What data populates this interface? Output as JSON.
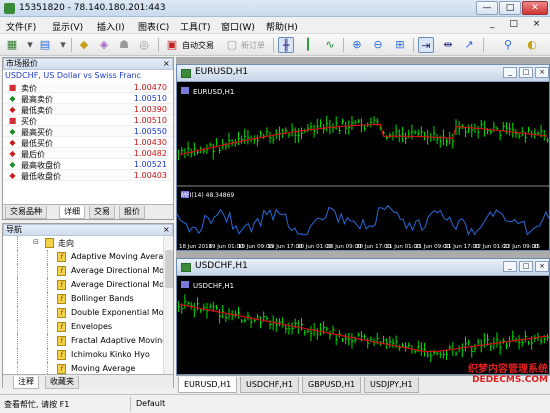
{
  "window": {
    "title": "15351820 - 78.140.180.201:443",
    "min": "—",
    "max": "□",
    "close": "✕"
  },
  "menu": [
    "文件(F)",
    "显示(V)",
    "插入(I)",
    "图表(C)",
    "工具(T)",
    "窗口(W)",
    "帮助(H)"
  ],
  "mdi_controls": "_ □ ×",
  "toolbar": {
    "auto_trade": "自动交易",
    "new_order": "新订单"
  },
  "market_watch": {
    "title": "市场报价",
    "close": "×",
    "symbol": "USDCHF, US Dollar vs Swiss Franc",
    "rows": [
      {
        "label": "卖价",
        "value": "1.00470",
        "arrow": "none"
      },
      {
        "label": "最高卖价",
        "value": "1.00510",
        "arrow": "up"
      },
      {
        "label": "最低卖价",
        "value": "1.00390",
        "arrow": "down"
      },
      {
        "label": "买价",
        "value": "1.00510",
        "arrow": "none"
      },
      {
        "label": "最高买价",
        "value": "1.00550",
        "arrow": "up"
      },
      {
        "label": "最低买价",
        "value": "1.00430",
        "arrow": "down"
      },
      {
        "label": "最后价",
        "value": "1.00482",
        "arrow": "down"
      },
      {
        "label": "最高收盘价",
        "value": "1.00521",
        "arrow": "up"
      },
      {
        "label": "最低收盘价",
        "value": "1.00403",
        "arrow": "down"
      }
    ],
    "tabs": [
      "交易品种",
      "详细",
      "交易",
      "报价"
    ],
    "active_tab": 1
  },
  "navigator": {
    "title": "导航",
    "close": "×",
    "folder": "走向",
    "items": [
      "Adaptive Moving Average",
      "Average Directional Movement",
      "Average Directional Movement Wilder",
      "Bollinger Bands",
      "Double Exponential Moving Average",
      "Envelopes",
      "Fractal Adaptive Moving Average",
      "Ichimoku Kinko Hyo",
      "Moving Average"
    ],
    "tabs": [
      "注释",
      "收藏夹"
    ],
    "active_tab": 0
  },
  "status": {
    "help": "查看帮忙, 请按 F1",
    "profile": "Default"
  },
  "charts": [
    {
      "window_title": "EURUSD,H1",
      "label": "EURUSD,H1",
      "indicator": "MFI(14) 48.34869",
      "time_labels": [
        "18 Jun 2018",
        "19 Jun 01:00",
        "19 Jun 09:00",
        "19 Jun 17:00",
        "20 Jun 01:00",
        "20 Jun 09:00",
        "20 Jun 17:00",
        "21 Jun 01:00",
        "21 Jun 09:00",
        "21 Jun 17:00",
        "22 Jun 01:00",
        "22 Jun 09:00",
        "25"
      ]
    },
    {
      "window_title": "USDCHF,H1",
      "label": "USDCHF,H1"
    }
  ],
  "chart_tabs": [
    "EURUSD,H1",
    "USDCHF,H1",
    "GBPUSD,H1",
    "USDJPY,H1"
  ],
  "active_chart_tab": 0,
  "watermark": {
    "line1": "织梦内容管理系统",
    "line2": "DEDECMS.COM"
  },
  "colors": {
    "candle_up": "#00e000",
    "ma_line": "#d01010",
    "mfi_line": "#2a6ad8",
    "panel_title": "#d0dced"
  }
}
